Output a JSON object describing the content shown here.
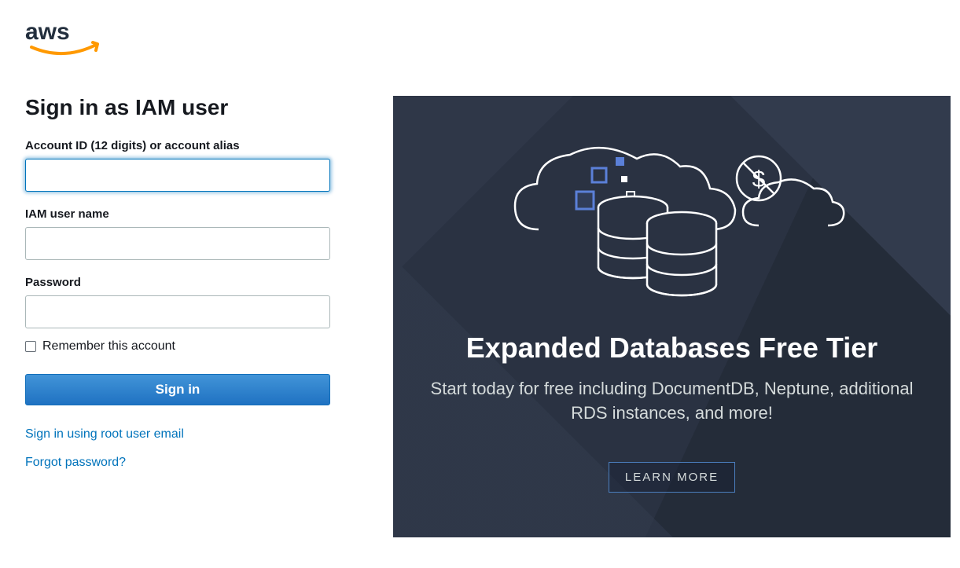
{
  "page_title": "Sign in as IAM user",
  "form": {
    "account_id_label": "Account ID (12 digits) or account alias",
    "account_id_value": "",
    "username_label": "IAM user name",
    "username_value": "",
    "password_label": "Password",
    "password_value": "",
    "remember_label": "Remember this account",
    "signin_button": "Sign in"
  },
  "links": {
    "root_signin": "Sign in using root user email",
    "forgot_password": "Forgot password?"
  },
  "banner": {
    "title": "Expanded Databases Free Tier",
    "description": "Start today for free including DocumentDB, Neptune, additional RDS instances, and more!",
    "cta": "LEARN MORE"
  },
  "colors": {
    "link": "#0073bb",
    "button_primary": "#2b7fc7",
    "banner_bg": "#2a3242"
  }
}
